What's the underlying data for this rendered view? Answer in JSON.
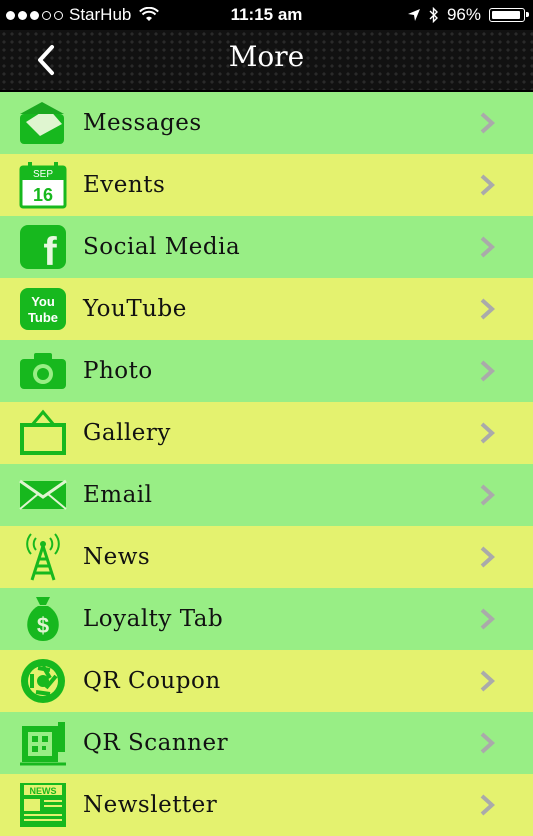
{
  "status_bar": {
    "carrier": "StarHub",
    "time": "11:15 am",
    "battery": "96%",
    "battery_level": 0.96,
    "signal_bars": 3
  },
  "navbar": {
    "title": "More",
    "back_icon": "chevron-left-icon"
  },
  "colors": {
    "row_green": "#98ee85",
    "row_yellow": "#e4f26f",
    "icon_green": "#17b81e"
  },
  "menu": {
    "items": [
      {
        "label": "Messages",
        "icon": "message-envelope-icon"
      },
      {
        "label": "Events",
        "icon": "calendar-icon",
        "icon_text": "SEP",
        "icon_day": "16"
      },
      {
        "label": "Social Media",
        "icon": "facebook-icon",
        "icon_text": "f"
      },
      {
        "label": "YouTube",
        "icon": "youtube-icon",
        "icon_text": "You",
        "icon_text2": "Tube"
      },
      {
        "label": "Photo",
        "icon": "camera-icon"
      },
      {
        "label": "Gallery",
        "icon": "picture-frame-icon"
      },
      {
        "label": "Email",
        "icon": "email-icon"
      },
      {
        "label": "News",
        "icon": "antenna-icon"
      },
      {
        "label": "Loyalty Tab",
        "icon": "money-bag-icon",
        "icon_text": "$"
      },
      {
        "label": "QR Coupon",
        "icon": "aperture-icon"
      },
      {
        "label": "QR Scanner",
        "icon": "qr-scanner-icon"
      },
      {
        "label": "Newsletter",
        "icon": "newspaper-icon",
        "icon_text": "NEWS"
      }
    ]
  }
}
